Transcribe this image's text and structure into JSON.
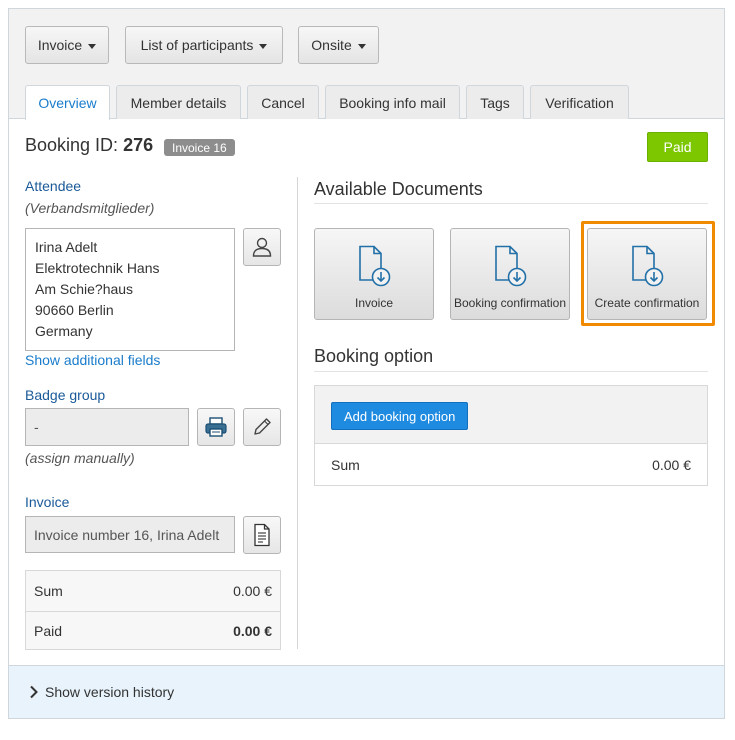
{
  "toolbar": {
    "invoice_label": "Invoice",
    "participants_label": "List of participants",
    "onsite_label": "Onsite"
  },
  "tabs": [
    {
      "label": "Overview",
      "active": true
    },
    {
      "label": "Member details"
    },
    {
      "label": "Cancel"
    },
    {
      "label": "Booking info mail"
    },
    {
      "label": "Tags"
    },
    {
      "label": "Verification"
    }
  ],
  "booking": {
    "id_label": "Booking ID:",
    "id_value": "276",
    "invoice_badge": "Invoice 16",
    "status": "Paid",
    "status_color": "#7cc700"
  },
  "attendee": {
    "label": "Attendee",
    "group": "(Verbandsmitglieder)",
    "address_lines": [
      "Irina Adelt",
      "Elektrotechnik Hans",
      "Am Schie?haus",
      "90660 Berlin",
      "Germany"
    ],
    "show_fields_link": "Show additional fields"
  },
  "badge_group": {
    "label": "Badge group",
    "value": "-",
    "note": "(assign manually)"
  },
  "invoice_section": {
    "label": "Invoice",
    "value": "Invoice number 16, Irina Adelt"
  },
  "summary": {
    "sum_label": "Sum",
    "sum_value": "0.00 €",
    "paid_label": "Paid",
    "paid_value": "0.00 €"
  },
  "documents": {
    "title": "Available Documents",
    "items": [
      {
        "label": "Invoice",
        "icon": "document-download-icon"
      },
      {
        "label": "Booking confirmation",
        "icon": "document-download-icon"
      },
      {
        "label": "Create confirmation",
        "icon": "document-download-icon",
        "highlighted": true
      }
    ],
    "highlight_color": "#f08a00"
  },
  "booking_option": {
    "title": "Booking option",
    "add_button": "Add booking option",
    "sum_label": "Sum",
    "sum_value": "0.00 €"
  },
  "footer": {
    "history_label": "Show version history"
  },
  "colors": {
    "link": "#1a7ccb",
    "primary": "#1e8be0",
    "footer_bg": "#e8f3fb"
  }
}
